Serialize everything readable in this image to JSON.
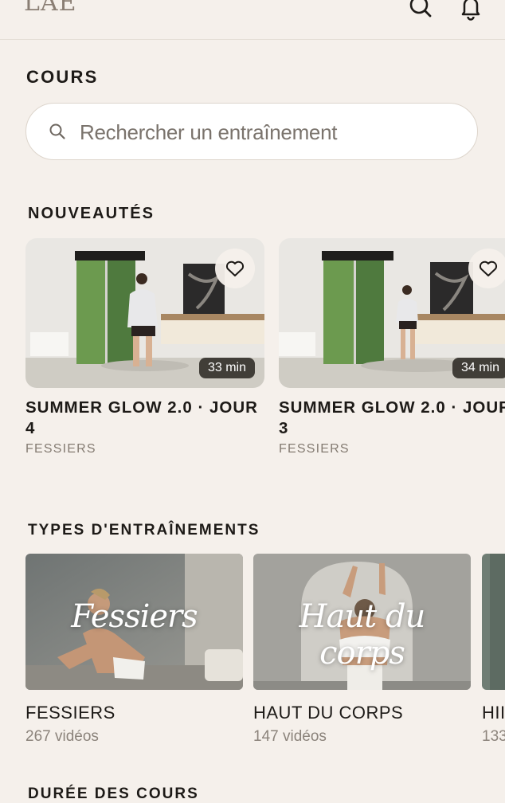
{
  "header": {
    "logo": "LAE"
  },
  "page_title": "COURS",
  "search": {
    "placeholder": "Rechercher un entraînement"
  },
  "new_section": {
    "title": "NOUVEAUTÉS",
    "cards": [
      {
        "title": "SUMMER GLOW 2.0 · JOUR 4",
        "category": "FESSIERS",
        "duration": "33 min"
      },
      {
        "title": "SUMMER GLOW 2.0 · JOUR 3",
        "category": "FESSIERS",
        "duration": "34 min"
      }
    ]
  },
  "types_section": {
    "title": "TYPES D'ENTRAÎNEMENTS",
    "items": [
      {
        "overlay": "Fessiers",
        "name": "FESSIERS",
        "count": "267 vidéos"
      },
      {
        "overlay": "Haut du corps",
        "name": "HAUT DU CORPS",
        "count": "147 vidéos"
      },
      {
        "overlay": "",
        "name": "HII",
        "count": "133"
      }
    ]
  },
  "duration_section": {
    "title": "DURÉE DES COURS"
  }
}
